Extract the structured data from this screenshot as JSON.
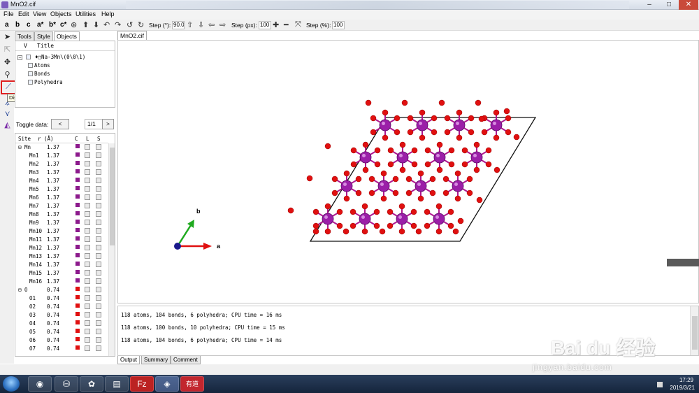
{
  "window": {
    "title": "MnO2.cif"
  },
  "menu": [
    "File",
    "Edit",
    "View",
    "Objects",
    "Utilities",
    "Help"
  ],
  "toolbar": {
    "axes": [
      "a",
      "b",
      "c",
      "a*",
      "b*",
      "c*"
    ],
    "step_deg_label": "Step (°):",
    "step_deg_value": "90.0",
    "step_px_label": "Step (px):",
    "step_px_value": "100",
    "step_pct_label": "Step (%):",
    "step_pct_value": "100"
  },
  "left_tabs": [
    "Tools",
    "Style",
    "Objects"
  ],
  "objects": {
    "header_v": "V",
    "header_title": "Title",
    "root": "♦□Na-3Mn\\(0\\0\\1)",
    "children": [
      "Atoms",
      "Bonds",
      "Polyhedra"
    ]
  },
  "tooltip": "Distance (d)",
  "toggle": {
    "label": "Toggle data:",
    "prev": "<",
    "value": "1/1",
    "next": ">"
  },
  "site_table": {
    "headers": [
      "Site",
      "r (Å)",
      "C",
      "L",
      "S"
    ],
    "rows": [
      {
        "site": "Mn",
        "r": "1.37",
        "group": true,
        "color": "#8c1a8c"
      },
      {
        "site": "Mn1",
        "r": "1.37",
        "color": "#8c1a8c"
      },
      {
        "site": "Mn2",
        "r": "1.37",
        "color": "#8c1a8c"
      },
      {
        "site": "Mn3",
        "r": "1.37",
        "color": "#8c1a8c"
      },
      {
        "site": "Mn4",
        "r": "1.37",
        "color": "#8c1a8c"
      },
      {
        "site": "Mn5",
        "r": "1.37",
        "color": "#8c1a8c"
      },
      {
        "site": "Mn6",
        "r": "1.37",
        "color": "#8c1a8c"
      },
      {
        "site": "Mn7",
        "r": "1.37",
        "color": "#8c1a8c"
      },
      {
        "site": "Mn8",
        "r": "1.37",
        "color": "#8c1a8c"
      },
      {
        "site": "Mn9",
        "r": "1.37",
        "color": "#8c1a8c"
      },
      {
        "site": "Mn10",
        "r": "1.37",
        "color": "#8c1a8c"
      },
      {
        "site": "Mn11",
        "r": "1.37",
        "color": "#8c1a8c"
      },
      {
        "site": "Mn12",
        "r": "1.37",
        "color": "#8c1a8c"
      },
      {
        "site": "Mn13",
        "r": "1.37",
        "color": "#8c1a8c"
      },
      {
        "site": "Mn14",
        "r": "1.37",
        "color": "#8c1a8c"
      },
      {
        "site": "Mn15",
        "r": "1.37",
        "color": "#8c1a8c"
      },
      {
        "site": "Mn16",
        "r": "1.37",
        "color": "#8c1a8c"
      },
      {
        "site": "O",
        "r": "0.74",
        "group": true,
        "color": "#e01010"
      },
      {
        "site": "O1",
        "r": "0.74",
        "color": "#e01010"
      },
      {
        "site": "O2",
        "r": "0.74",
        "color": "#e01010"
      },
      {
        "site": "O3",
        "r": "0.74",
        "color": "#e01010"
      },
      {
        "site": "O4",
        "r": "0.74",
        "color": "#e01010"
      },
      {
        "site": "O5",
        "r": "0.74",
        "color": "#e01010"
      },
      {
        "site": "O6",
        "r": "0.74",
        "color": "#e01010"
      },
      {
        "site": "O7",
        "r": "0.74",
        "color": "#e01010"
      }
    ]
  },
  "document_tab": "MnO2.cif",
  "axes_labels": {
    "a": "a",
    "b": "b"
  },
  "colors": {
    "mn": "#9b1fa8",
    "o": "#e01010",
    "a_axis": "#e01010",
    "b_axis": "#1faa1f",
    "c_axis": "#1a1a8c"
  },
  "output": {
    "lines": [
      "118 atoms, 104 bonds, 6 polyhedra; CPU time = 16 ms",
      "118 atoms, 100 bonds, 10 polyhedra; CPU time = 15 ms",
      "118 atoms, 104 bonds, 6 polyhedra; CPU time = 14 ms"
    ],
    "tabs": [
      "Output",
      "Summary",
      "Comment"
    ]
  },
  "watermark": {
    "text": "Bai du 经验",
    "sub": "jingyan.baidu.com"
  },
  "taskbar": {
    "apps": [
      "chrome",
      "network",
      "app",
      "folder",
      "filezilla",
      "vesta",
      "youdao"
    ],
    "youdao_label": "有道",
    "time": "17:29",
    "date": "2019/3/21"
  }
}
